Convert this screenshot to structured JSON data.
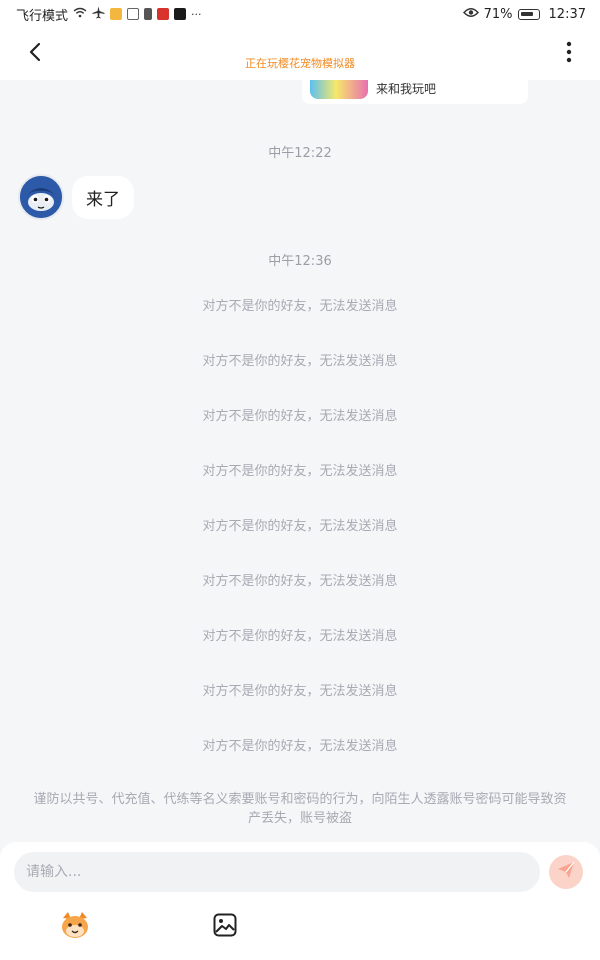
{
  "status_bar": {
    "left_text": "飞行模式",
    "battery": "71%",
    "time": "12:37"
  },
  "header": {
    "subtitle": "正在玩樱花宠物模拟器"
  },
  "game_card": {
    "text": "来和我玩吧"
  },
  "messages": {
    "time1": "中午12:22",
    "reply": "来了",
    "time2": "中午12:36",
    "system": [
      "对方不是你的好友，无法发送消息",
      "对方不是你的好友，无法发送消息",
      "对方不是你的好友，无法发送消息",
      "对方不是你的好友，无法发送消息",
      "对方不是你的好友，无法发送消息",
      "对方不是你的好友，无法发送消息",
      "对方不是你的好友，无法发送消息",
      "对方不是你的好友，无法发送消息",
      "对方不是你的好友，无法发送消息"
    ],
    "warning": "谨防以共号、代充值、代练等名义索要账号和密码的行为，向陌生人透露账号密码可能导致资产丢失，账号被盗"
  },
  "input": {
    "placeholder": "请输入..."
  },
  "colors": {
    "accent": "#f08a24",
    "send": "#f26a4f",
    "background": "#f5f6f8"
  },
  "icons": [
    "back-icon",
    "more-icon",
    "send-icon",
    "emoji-icon",
    "image-icon"
  ]
}
